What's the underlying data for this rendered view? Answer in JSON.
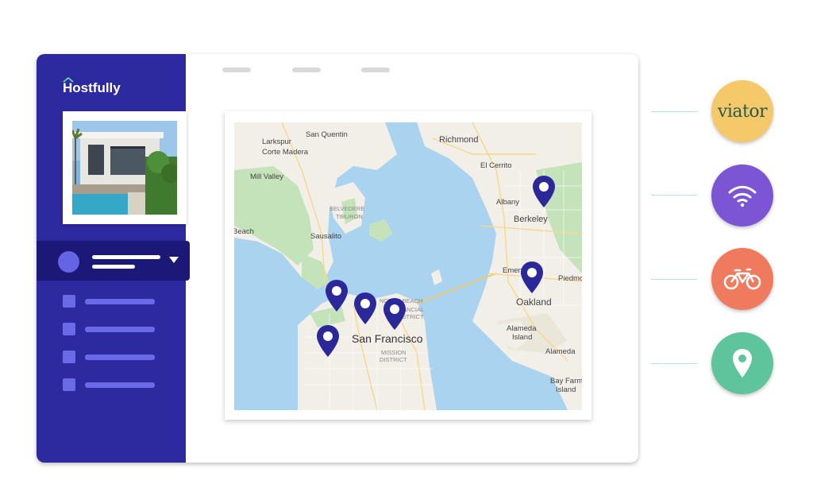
{
  "app": {
    "logo_text": "Hostfully"
  },
  "sidebar": {
    "menu_items": [
      {
        "name": "menu-item-1"
      },
      {
        "name": "menu-item-2"
      },
      {
        "name": "menu-item-3"
      },
      {
        "name": "menu-item-4"
      }
    ]
  },
  "map": {
    "labels": {
      "san_quentin": "San Quentin",
      "larkspur": "Larkspur",
      "corte_madera": "Corte Madera",
      "mill_valley": "Mill Valley",
      "belvedere": "BELVEDERE",
      "tiburon": "TIBURON",
      "sausalito": "Sausalito",
      "beach": "Beach",
      "richmond": "Richmond",
      "el_cerrito": "El Cerrito",
      "albany": "Albany",
      "berkeley": "Berkeley",
      "emeryville": "Emeryville",
      "piedmont": "Piedmo",
      "oakland": "Oakland",
      "alameda_island_1": "Alameda",
      "alameda_island_2": "Island",
      "alameda": "Alameda",
      "bay_farm_1": "Bay Farm",
      "bay_farm_2": "Island",
      "north_beach": "NORTH BEACH",
      "financial_1": "FINANCIAL",
      "financial_2": "DISTRICT",
      "san_francisco": "San Francisco",
      "mission_1": "MISSION",
      "mission_2": "DISTRICT"
    },
    "pin_color": "#2b2899"
  },
  "integrations": [
    {
      "name": "viator",
      "label": "viator",
      "color": "#f5c86a"
    },
    {
      "name": "wifi",
      "icon": "wifi-icon",
      "color": "#7b55d4"
    },
    {
      "name": "bike",
      "icon": "bicycle-icon",
      "color": "#ef7a5d"
    },
    {
      "name": "location",
      "icon": "map-pin-icon",
      "color": "#5ec49b"
    }
  ],
  "colors": {
    "sidebar": "#2d2aa0",
    "sidebar_active": "#1c1878",
    "accent": "#6b6ae6",
    "water": "#a9d3ee",
    "land": "#f2efe9",
    "park": "#c5e3bb"
  }
}
